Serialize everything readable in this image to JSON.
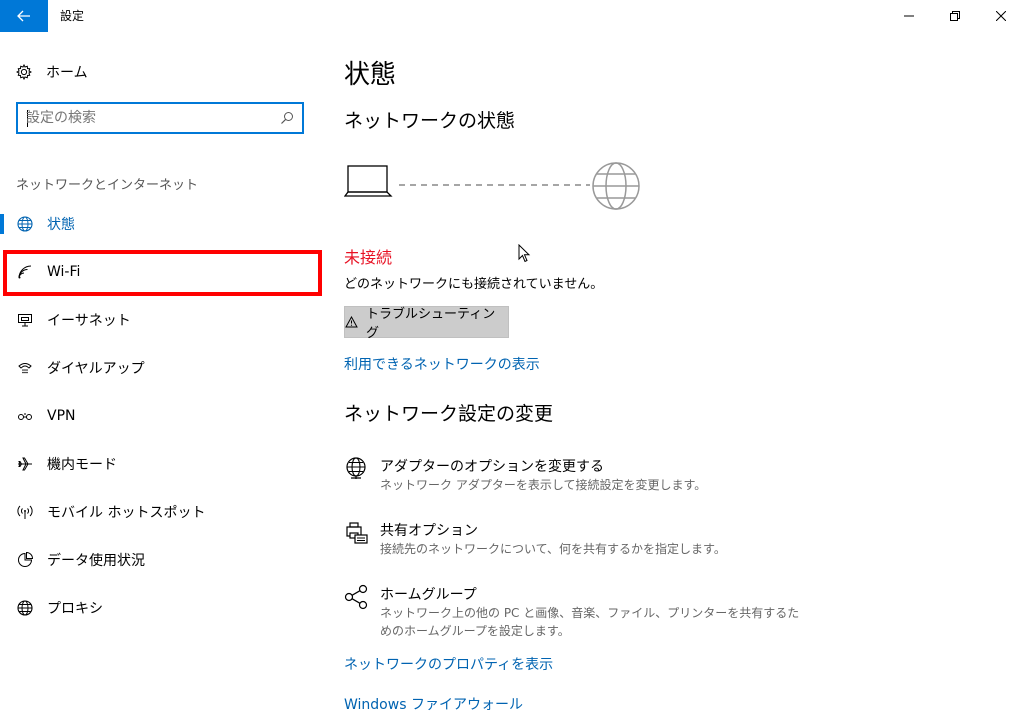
{
  "window": {
    "title": "設定"
  },
  "sidebar": {
    "home_label": "ホーム",
    "search_placeholder": "設定の検索",
    "section_title": "ネットワークとインターネット",
    "items": [
      {
        "label": "状態",
        "icon": "globe-icon",
        "active": true
      },
      {
        "label": "Wi-Fi",
        "icon": "wifi-icon",
        "highlighted": true
      },
      {
        "label": "イーサネット",
        "icon": "ethernet-icon"
      },
      {
        "label": "ダイヤルアップ",
        "icon": "dialup-icon"
      },
      {
        "label": "VPN",
        "icon": "vpn-icon"
      },
      {
        "label": "機内モード",
        "icon": "airplane-icon"
      },
      {
        "label": "モバイル ホットスポット",
        "icon": "hotspot-icon"
      },
      {
        "label": "データ使用状況",
        "icon": "data-usage-icon"
      },
      {
        "label": "プロキシ",
        "icon": "proxy-globe-icon"
      }
    ]
  },
  "main": {
    "page_title": "状態",
    "network_status_header": "ネットワークの状態",
    "connection_status": "未接続",
    "connection_description": "どのネットワークにも接続されていません。",
    "troubleshoot_label": "トラブルシューティング",
    "show_available_link": "利用できるネットワークの表示",
    "change_settings_header": "ネットワーク設定の変更",
    "options": {
      "adapter": {
        "title": "アダプターのオプションを変更する",
        "description": "ネットワーク アダプターを表示して接続設定を変更します。"
      },
      "sharing": {
        "title": "共有オプション",
        "description": "接続先のネットワークについて、何を共有するかを指定します。"
      },
      "homegroup": {
        "title": "ホームグループ",
        "description": "ネットワーク上の他の PC と画像、音楽、ファイル、プリンターを共有するためのホームグループを設定します。"
      }
    },
    "properties_link": "ネットワークのプロパティを表示",
    "firewall_link": "Windows ファイアウォール"
  },
  "colors": {
    "accent": "#0078d7",
    "link": "#0063b1",
    "error": "#e81123",
    "highlight_box": "#ff0000"
  }
}
